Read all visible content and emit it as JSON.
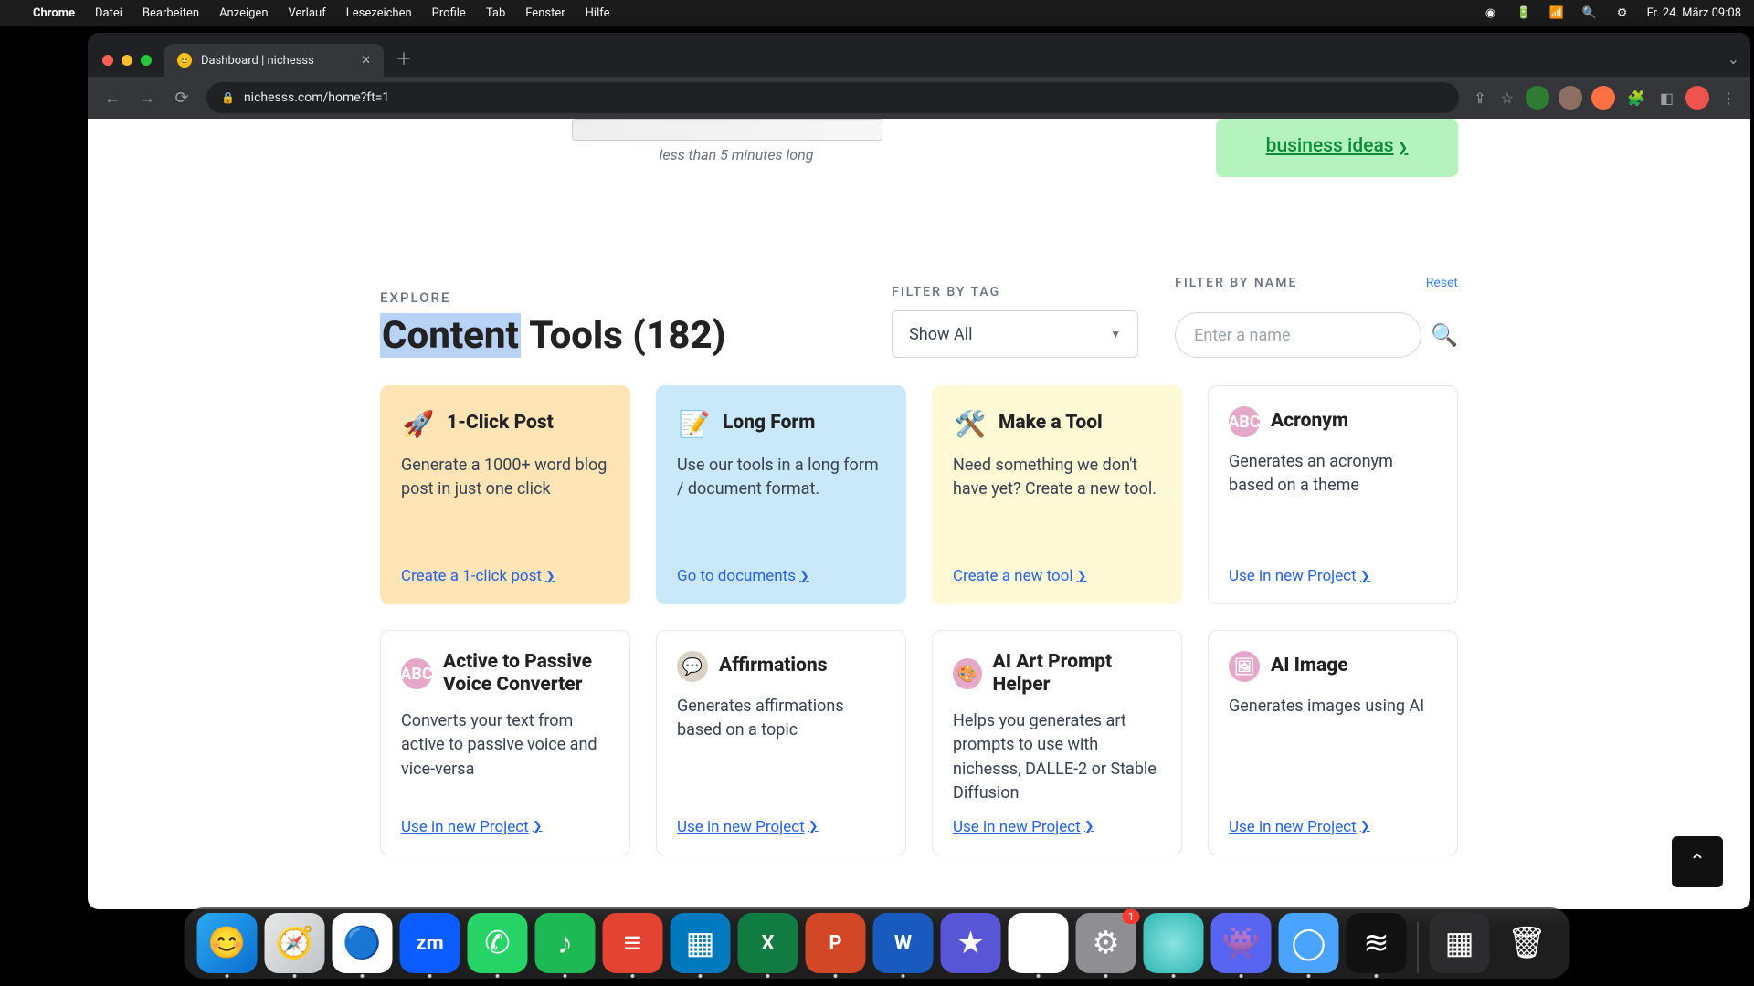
{
  "menubar": {
    "app": "Chrome",
    "items": [
      "Datei",
      "Bearbeiten",
      "Anzeigen",
      "Verlauf",
      "Lesezeichen",
      "Profile",
      "Tab",
      "Fenster",
      "Hilfe"
    ],
    "clock": "Fr. 24. März 09:08"
  },
  "browser": {
    "tab_title": "Dashboard | nichesss",
    "url": "nichesss.com/home?ft=1"
  },
  "top": {
    "video_caption": "less than 5 minutes long",
    "biz_link": "business ideas"
  },
  "filters": {
    "explore_label": "EXPLORE",
    "title_hl": "Content",
    "title_rest": " Tools (182)",
    "tag_label": "FILTER BY TAG",
    "tag_value": "Show All",
    "name_label": "FILTER BY NAME",
    "reset": "Reset",
    "name_placeholder": "Enter a name"
  },
  "cards": [
    {
      "icon": "🚀",
      "title": "1-Click Post",
      "desc": "Generate a 1000+ word blog post in just one click",
      "link": "Create a 1-click post",
      "variant": "orange"
    },
    {
      "icon": "📝",
      "title": "Long Form",
      "desc": "Use our tools in a long form / document format.",
      "link": "Go to documents",
      "variant": "blue"
    },
    {
      "icon": "🛠️",
      "title": "Make a Tool",
      "desc": "Need something we don't have yet? Create a new tool.",
      "link": "Create a new tool",
      "variant": "yellow"
    },
    {
      "icon": "pill",
      "icon_text": "ABC",
      "title": "Acronym",
      "desc": "Generates an acronym based on a theme",
      "link": "Use in new Project",
      "variant": "plain"
    },
    {
      "icon": "pill",
      "icon_text": "ABC",
      "title": "Active to Passive Voice Converter",
      "desc": "Converts your text from active to passive voice and vice-versa",
      "link": "Use in new Project",
      "variant": "plain"
    },
    {
      "icon": "pill",
      "icon_text": "💬",
      "pill_bg": "#d9d2c5",
      "title": "Affirmations",
      "desc": "Generates affirmations based on a topic",
      "link": "Use in new Project",
      "variant": "plain"
    },
    {
      "icon": "pill",
      "icon_text": "🎨",
      "pill_bg": "#e5a8c9",
      "title": "AI Art Prompt Helper",
      "desc": "Helps you generates art prompts to use with nichesss, DALLE-2 or Stable Diffusion",
      "link": "Use in new Project",
      "variant": "plain"
    },
    {
      "icon": "pill",
      "icon_text": "🖼",
      "pill_bg": "#e5a8c9",
      "title": "AI Image",
      "desc": "Generates images using AI",
      "link": "Use in new Project",
      "variant": "plain"
    }
  ],
  "dock": {
    "items": [
      {
        "name": "finder",
        "bg": "linear-gradient(135deg,#2aa9f3,#0a6ed1)",
        "glyph": "😊",
        "running": true
      },
      {
        "name": "safari",
        "bg": "linear-gradient(135deg,#e8e8e8,#bfc3c7)",
        "glyph": "🧭",
        "running": true
      },
      {
        "name": "chrome",
        "bg": "#fff",
        "glyph": "🔵",
        "running": true
      },
      {
        "name": "zoom",
        "bg": "#0b5cff",
        "glyph": "zm",
        "running": true,
        "text": true
      },
      {
        "name": "whatsapp",
        "bg": "#25d366",
        "glyph": "✆",
        "running": true
      },
      {
        "name": "spotify",
        "bg": "#1db954",
        "glyph": "♪",
        "running": true
      },
      {
        "name": "todoist",
        "bg": "#e44332",
        "glyph": "≡",
        "running": true
      },
      {
        "name": "trello",
        "bg": "#0079bf",
        "glyph": "▦",
        "running": true
      },
      {
        "name": "excel",
        "bg": "#107c41",
        "glyph": "X",
        "running": true,
        "text": true
      },
      {
        "name": "powerpoint",
        "bg": "#d24726",
        "glyph": "P",
        "running": true,
        "text": true
      },
      {
        "name": "word",
        "bg": "#185abd",
        "glyph": "W",
        "running": true,
        "text": true
      },
      {
        "name": "imovie",
        "bg": "#5856d6",
        "glyph": "★",
        "running": false
      },
      {
        "name": "drive",
        "bg": "#fff",
        "glyph": "▲",
        "running": true
      },
      {
        "name": "settings",
        "bg": "#8e8e93",
        "glyph": "⚙",
        "running": true,
        "badge": "1"
      },
      {
        "name": "app-teal",
        "bg": "radial-gradient(circle,#8be3e0,#2bb7b3)",
        "glyph": "",
        "running": true
      },
      {
        "name": "discord",
        "bg": "#5865f2",
        "glyph": "👾",
        "running": true
      },
      {
        "name": "app-blue",
        "bg": "#4aa3ff",
        "glyph": "◯",
        "running": true
      },
      {
        "name": "voice",
        "bg": "#111",
        "glyph": "≋",
        "running": true
      }
    ],
    "right": [
      {
        "name": "mission",
        "bg": "#2c2c2e",
        "glyph": "▦"
      },
      {
        "name": "trash",
        "bg": "transparent",
        "glyph": "🗑"
      }
    ]
  }
}
